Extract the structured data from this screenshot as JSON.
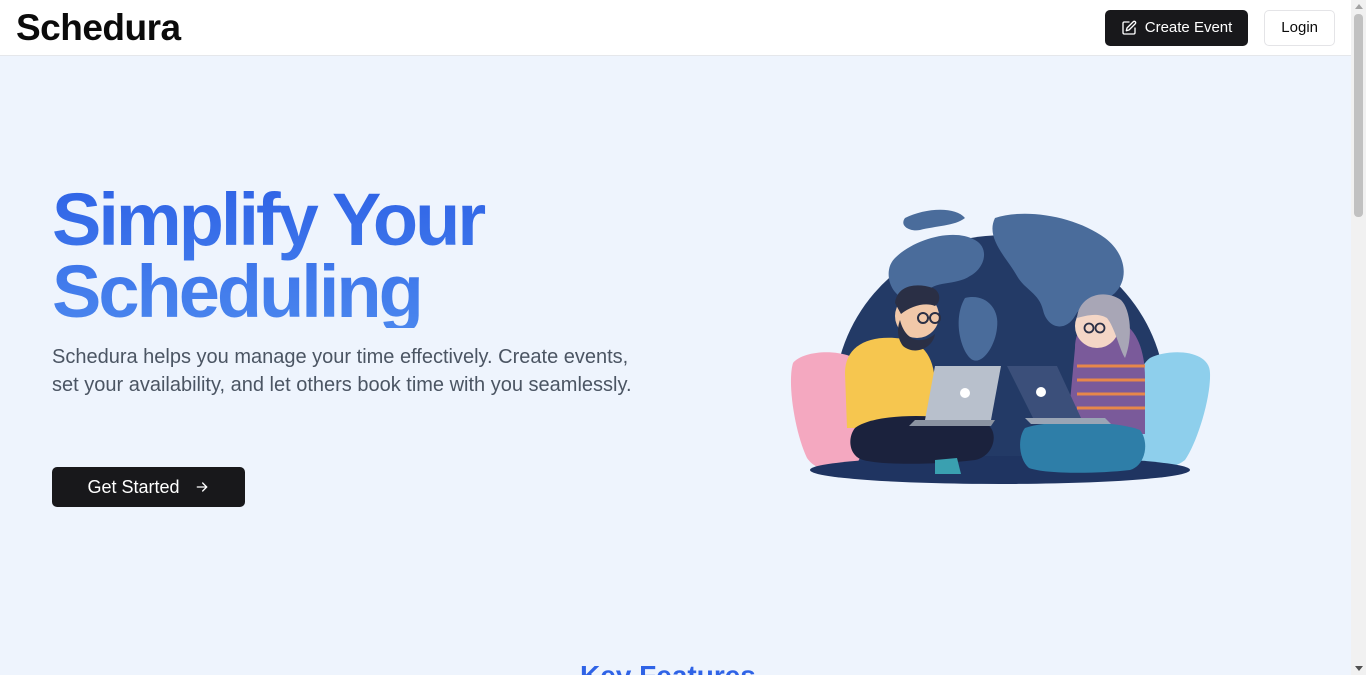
{
  "header": {
    "logo": "Schedura",
    "create_event_label": "Create Event",
    "login_label": "Login"
  },
  "hero": {
    "title_line1": "Simplify Your",
    "title_line2": "Scheduling",
    "description": "Schedura helps you manage your time effectively. Create events, set your availability, and let others book time with you seamlessly.",
    "cta_label": "Get Started"
  },
  "next_section": {
    "heading": "Key Features"
  },
  "colors": {
    "accent": "#3b6fe8",
    "dark_button": "#18181b",
    "page_bg": "#eef4fd"
  },
  "icons": {
    "create_event": "pencil-square-icon",
    "cta": "arrow-right-icon"
  }
}
